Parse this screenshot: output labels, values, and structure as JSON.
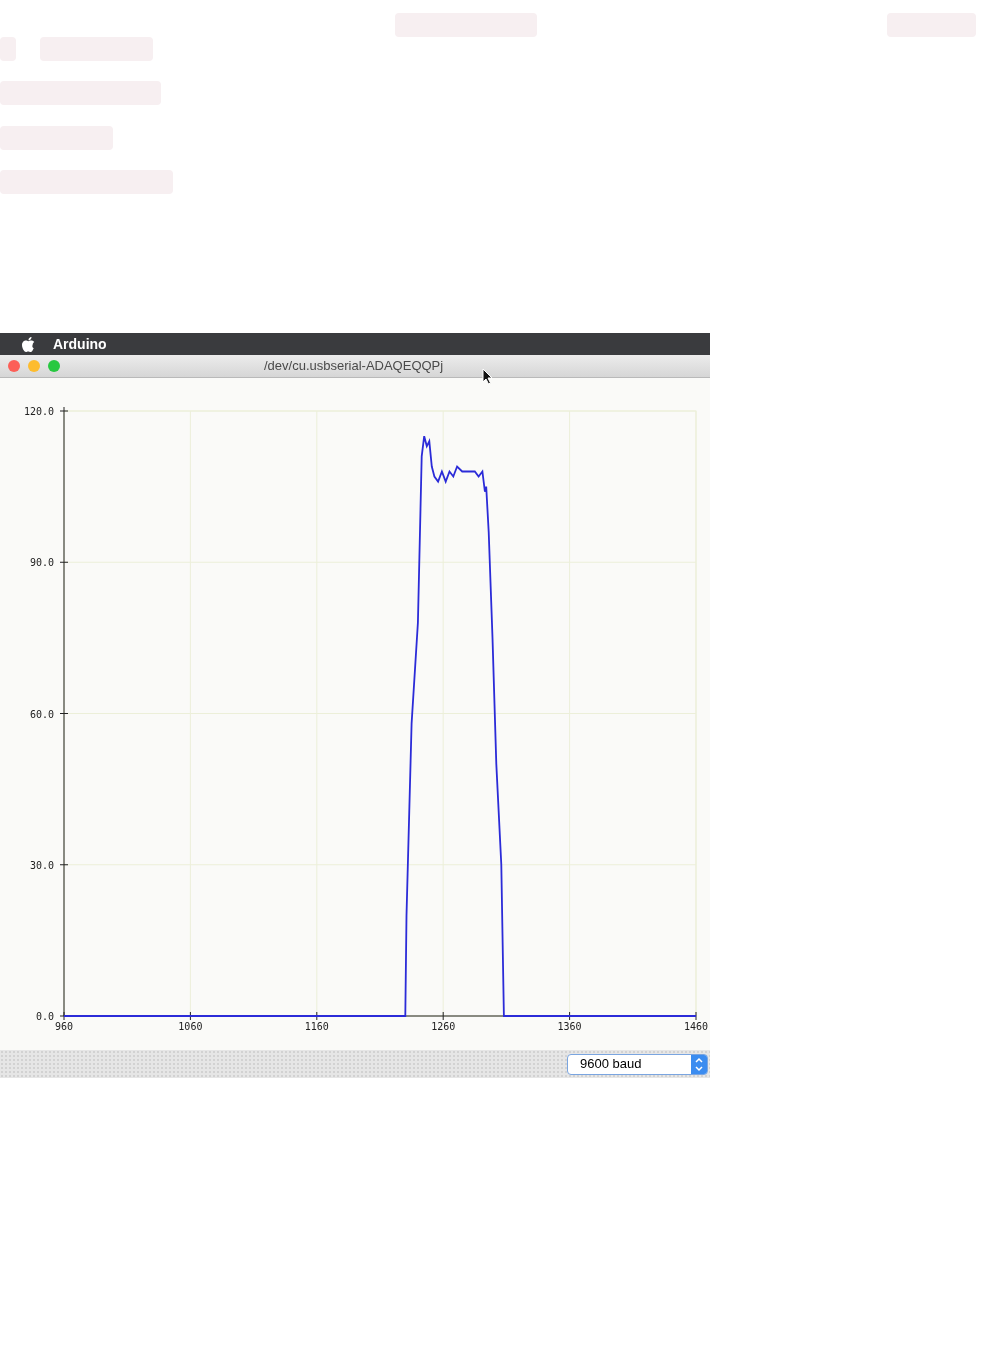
{
  "loading_placeholders": [
    {
      "kind": "skeleton"
    },
    {
      "kind": "skeleton"
    },
    {
      "kind": "skeleton"
    },
    {
      "kind": "skeleton"
    },
    {
      "kind": "skeleton"
    },
    {
      "kind": "skeleton"
    },
    {
      "kind": "skeleton"
    }
  ],
  "menu_bar": {
    "app_name": "Arduino"
  },
  "window": {
    "title": "/dev/cu.usbserial-ADAQEQQPj"
  },
  "plotter": {
    "chart_data": {
      "type": "line",
      "x": [
        960,
        1230,
        1231,
        1235,
        1240,
        1243,
        1245,
        1247,
        1249,
        1251,
        1253,
        1256,
        1259,
        1262,
        1265,
        1268,
        1271,
        1275,
        1280,
        1285,
        1288,
        1291,
        1293,
        1294,
        1296,
        1299,
        1302,
        1306,
        1308,
        1460
      ],
      "grid": true,
      "series": [
        {
          "color": "#2b2bd8",
          "values": [
            0,
            0,
            20,
            58,
            78,
            111,
            115,
            113,
            114,
            109,
            107,
            106,
            108,
            106,
            108,
            107,
            109,
            108,
            108,
            108,
            107,
            108,
            104,
            105,
            96,
            75,
            50,
            30,
            0,
            0
          ]
        }
      ],
      "xlim": [
        960,
        1460
      ],
      "ylim": [
        0,
        120
      ],
      "xticks": [
        960,
        1060,
        1160,
        1260,
        1360,
        1460
      ],
      "yticks": [
        {
          "value": 0,
          "label": "0.0"
        },
        {
          "value": 30,
          "label": "30.0"
        },
        {
          "value": 60,
          "label": "60.0"
        },
        {
          "value": 90,
          "label": "90.0"
        },
        {
          "value": 120,
          "label": "120.0"
        }
      ]
    }
  },
  "baud_select": {
    "value": "9600 baud"
  }
}
